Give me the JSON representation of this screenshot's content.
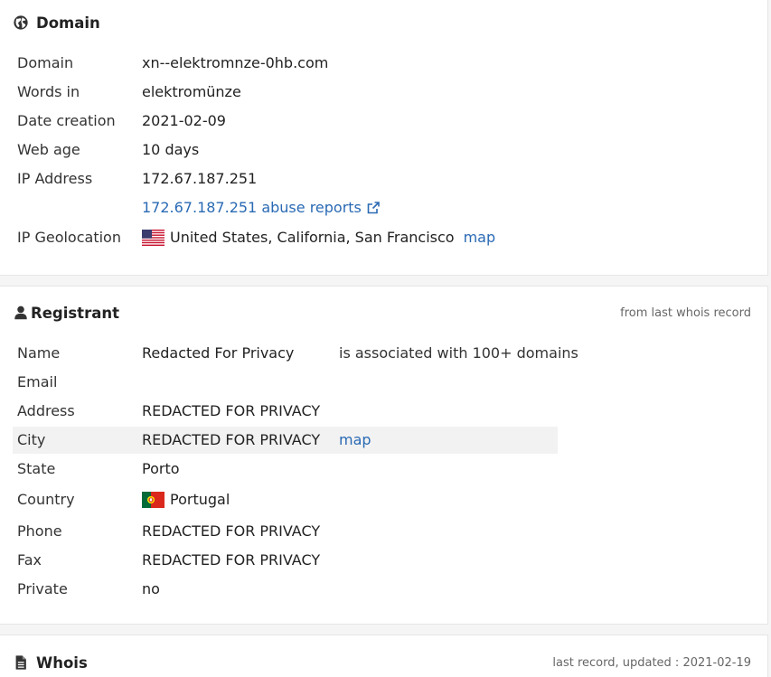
{
  "domain_section": {
    "title": "Domain",
    "rows": {
      "domain": {
        "label": "Domain",
        "value": "xn--elektromnze-0hb.com"
      },
      "words": {
        "label": "Words in",
        "value": "elektromünze"
      },
      "date_creation": {
        "label": "Date creation",
        "value": "2021-02-09"
      },
      "web_age": {
        "label": "Web age",
        "value": "10 days"
      },
      "ip_address": {
        "label": "IP Address",
        "value": "172.67.187.251"
      },
      "abuse": {
        "value": "172.67.187.251 abuse reports"
      },
      "geolocation": {
        "label": "IP Geolocation",
        "value": "United States, California, San Francisco",
        "map_link": "map"
      }
    }
  },
  "registrant_section": {
    "title": "Registrant",
    "note": "from last whois record",
    "rows": {
      "name": {
        "label": "Name",
        "value": "Redacted For Privacy",
        "extra": "is associated with 100+ domains"
      },
      "email": {
        "label": "Email",
        "value": ""
      },
      "address": {
        "label": "Address",
        "value": "REDACTED FOR PRIVACY"
      },
      "city": {
        "label": "City",
        "value": "REDACTED FOR PRIVACY",
        "map_link": "map"
      },
      "state": {
        "label": "State",
        "value": "Porto"
      },
      "country": {
        "label": "Country",
        "value": "Portugal"
      },
      "phone": {
        "label": "Phone",
        "value": "REDACTED FOR PRIVACY"
      },
      "fax": {
        "label": "Fax",
        "value": "REDACTED FOR PRIVACY"
      },
      "private": {
        "label": "Private",
        "value": "no"
      }
    }
  },
  "whois_section": {
    "title": "Whois",
    "note": "last record, updated : 2021-02-19"
  },
  "colors": {
    "link": "#2a6ab4",
    "text": "#222222",
    "highlight_row": "#f2f2f2"
  }
}
